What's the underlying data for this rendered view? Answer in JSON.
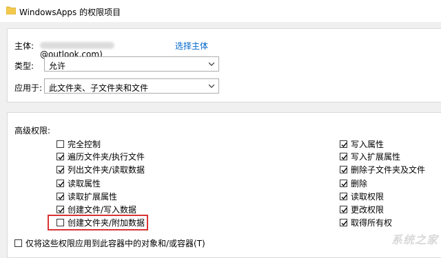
{
  "window": {
    "title": "WindowsApps 的权限项目"
  },
  "principal": {
    "label": "主体:",
    "value_suffix": "@outlook.com)",
    "change_link": "选择主体"
  },
  "type": {
    "label": "类型:",
    "selected": "允许"
  },
  "applies_to": {
    "label": "应用于:",
    "selected": "此文件夹、子文件夹和文件"
  },
  "advanced": {
    "title": "高级权限:",
    "left": [
      {
        "label": "完全控制",
        "checked": false
      },
      {
        "label": "遍历文件夹/执行文件",
        "checked": true
      },
      {
        "label": "列出文件夹/读取数据",
        "checked": true
      },
      {
        "label": "读取属性",
        "checked": true
      },
      {
        "label": "读取扩展属性",
        "checked": true
      },
      {
        "label": "创建文件/写入数据",
        "checked": true
      },
      {
        "label": "创建文件夹/附加数据",
        "checked": false
      }
    ],
    "right": [
      {
        "label": "写入属性",
        "checked": true
      },
      {
        "label": "写入扩展属性",
        "checked": true
      },
      {
        "label": "删除子文件夹及文件",
        "checked": true
      },
      {
        "label": "删除",
        "checked": true
      },
      {
        "label": "读取权限",
        "checked": true
      },
      {
        "label": "更改权限",
        "checked": true
      },
      {
        "label": "取得所有权",
        "checked": true
      }
    ]
  },
  "apply_only": {
    "label": "仅将这些权限应用到此容器中的对象和/或容器(T)",
    "checked": false
  },
  "watermark": "系统之家"
}
